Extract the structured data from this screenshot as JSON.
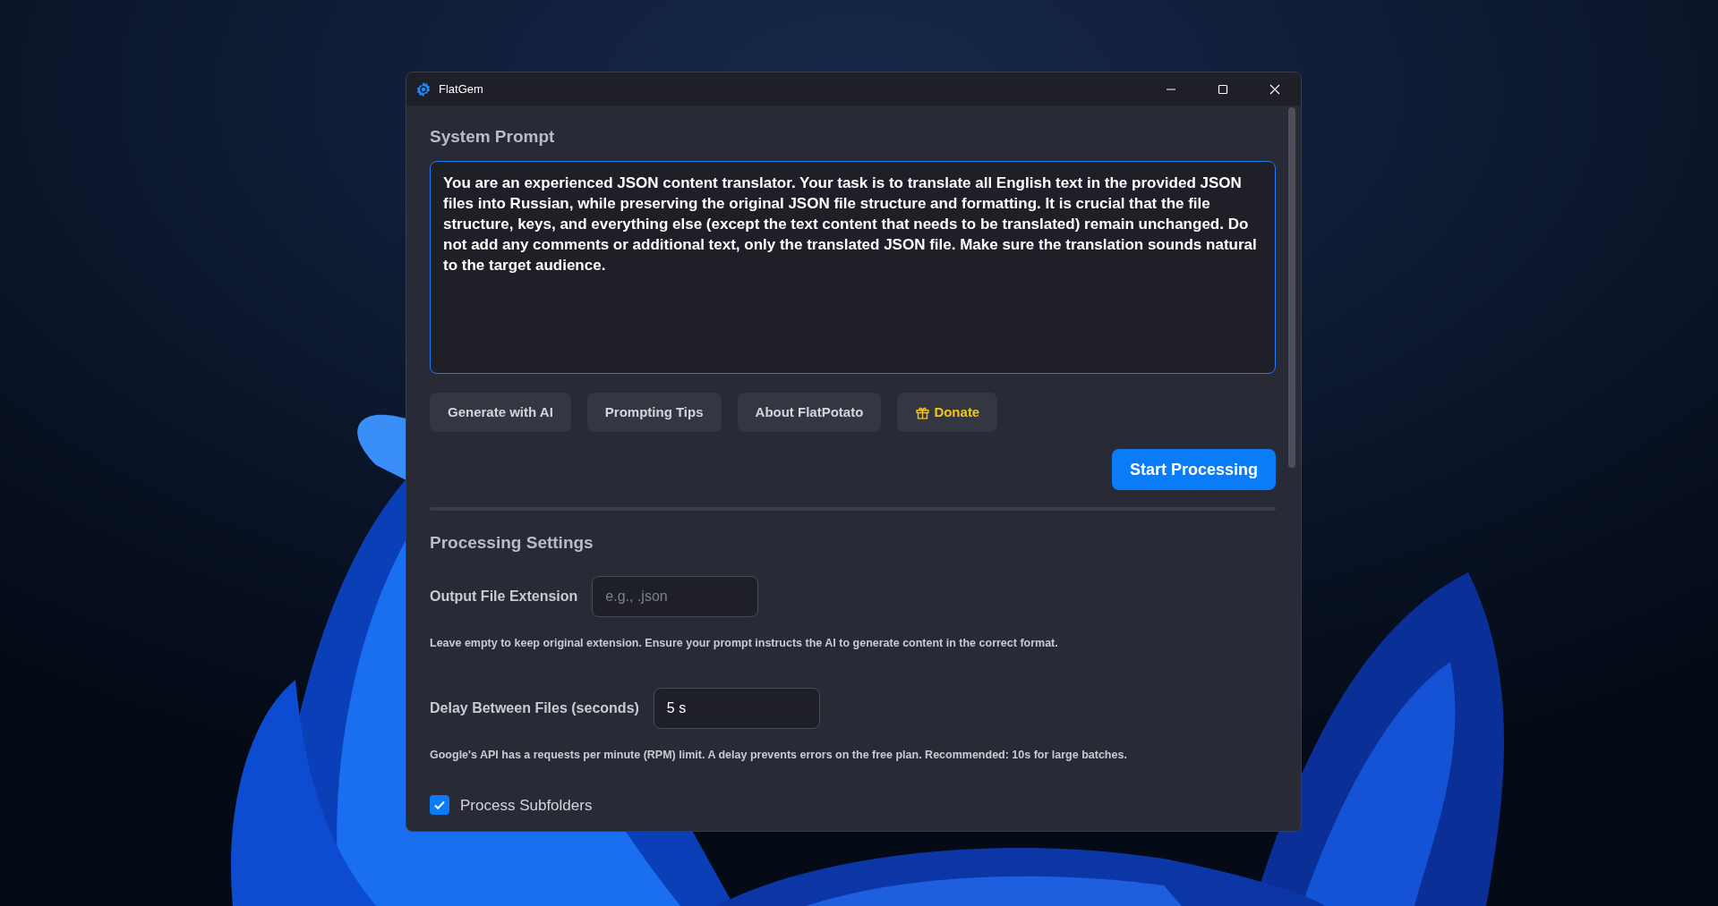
{
  "window": {
    "title": "FlatGem"
  },
  "system_prompt": {
    "heading": "System Prompt",
    "text": "You are an experienced JSON content translator. Your task is to translate all English text in the provided JSON files into Russian, while preserving the original JSON file structure and formatting. It is crucial that the file structure, keys, and everything else (except the text content that needs to be translated) remain unchanged. Do not add any comments or additional text, only the translated JSON file. Make sure the translation sounds natural to the target audience.",
    "focused": true
  },
  "actions": [
    {
      "label": "Generate with AI",
      "kind": "plain"
    },
    {
      "label": "Prompting Tips",
      "kind": "plain"
    },
    {
      "label": "About FlatPotato",
      "kind": "plain"
    },
    {
      "label": "Donate",
      "kind": "donate"
    }
  ],
  "primary_button": {
    "label": "Start Processing"
  },
  "processing_settings": {
    "heading": "Processing Settings",
    "fields": [
      {
        "label": "Output File Extension",
        "placeholder": "e.g., .json",
        "help": "Leave empty to keep original extension. Ensure your prompt instructs the AI to generate content in the correct format."
      },
      {
        "label": "Delay Between Files (seconds)",
        "value": "5 s",
        "help": "Google's API has a requests per minute (RPM) limit. A delay prevents errors on the free plan. Recommended: 10s for large batches."
      }
    ],
    "checkbox": {
      "label": "Process Subfolders",
      "checked": true
    }
  }
}
